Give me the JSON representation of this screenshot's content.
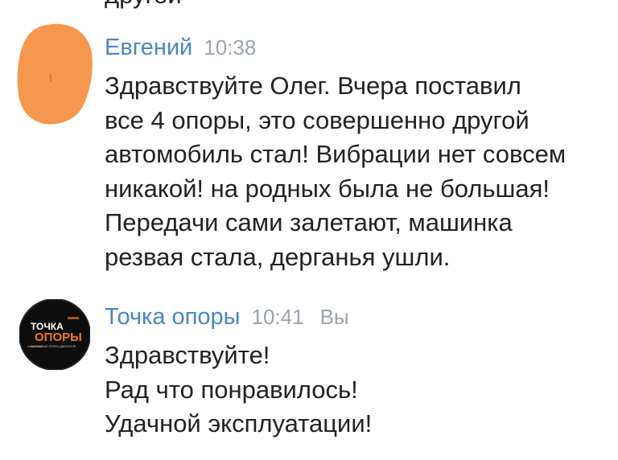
{
  "previous_message": {
    "tail_text": "другой"
  },
  "messages": [
    {
      "author": "Евгений",
      "time": "10:38",
      "avatar_color": "#f5974e",
      "lines": [
        "Здравствуйте Олег. Вчера поставил",
        "все 4 опоры, это совершенно другой",
        "автомобиль стал! Вибрации нет совсем",
        "никакой! на родных была не большая!",
        "Передачи сами залетают, машинка",
        "резвая стала, дерганья ушли."
      ]
    },
    {
      "author": "Точка опоры",
      "time": "10:41",
      "you_label": "Вы",
      "avatar_color": "#0d0d0d",
      "logo": {
        "line1": "ТОЧКА",
        "line2": "ОПОРЫ",
        "tagline": "КАСТОМНЫЕ ОПОРЫ ДВИГАТЕЛЯ",
        "accent": "#f07a1a"
      },
      "lines": [
        "Здравствуйте!",
        "Рад что понравилось!",
        "Удачной эксплуатации!"
      ]
    }
  ],
  "colors": {
    "author_name": "#4a86c4",
    "meta_text": "#9aa3ad",
    "message_text": "#222222"
  }
}
